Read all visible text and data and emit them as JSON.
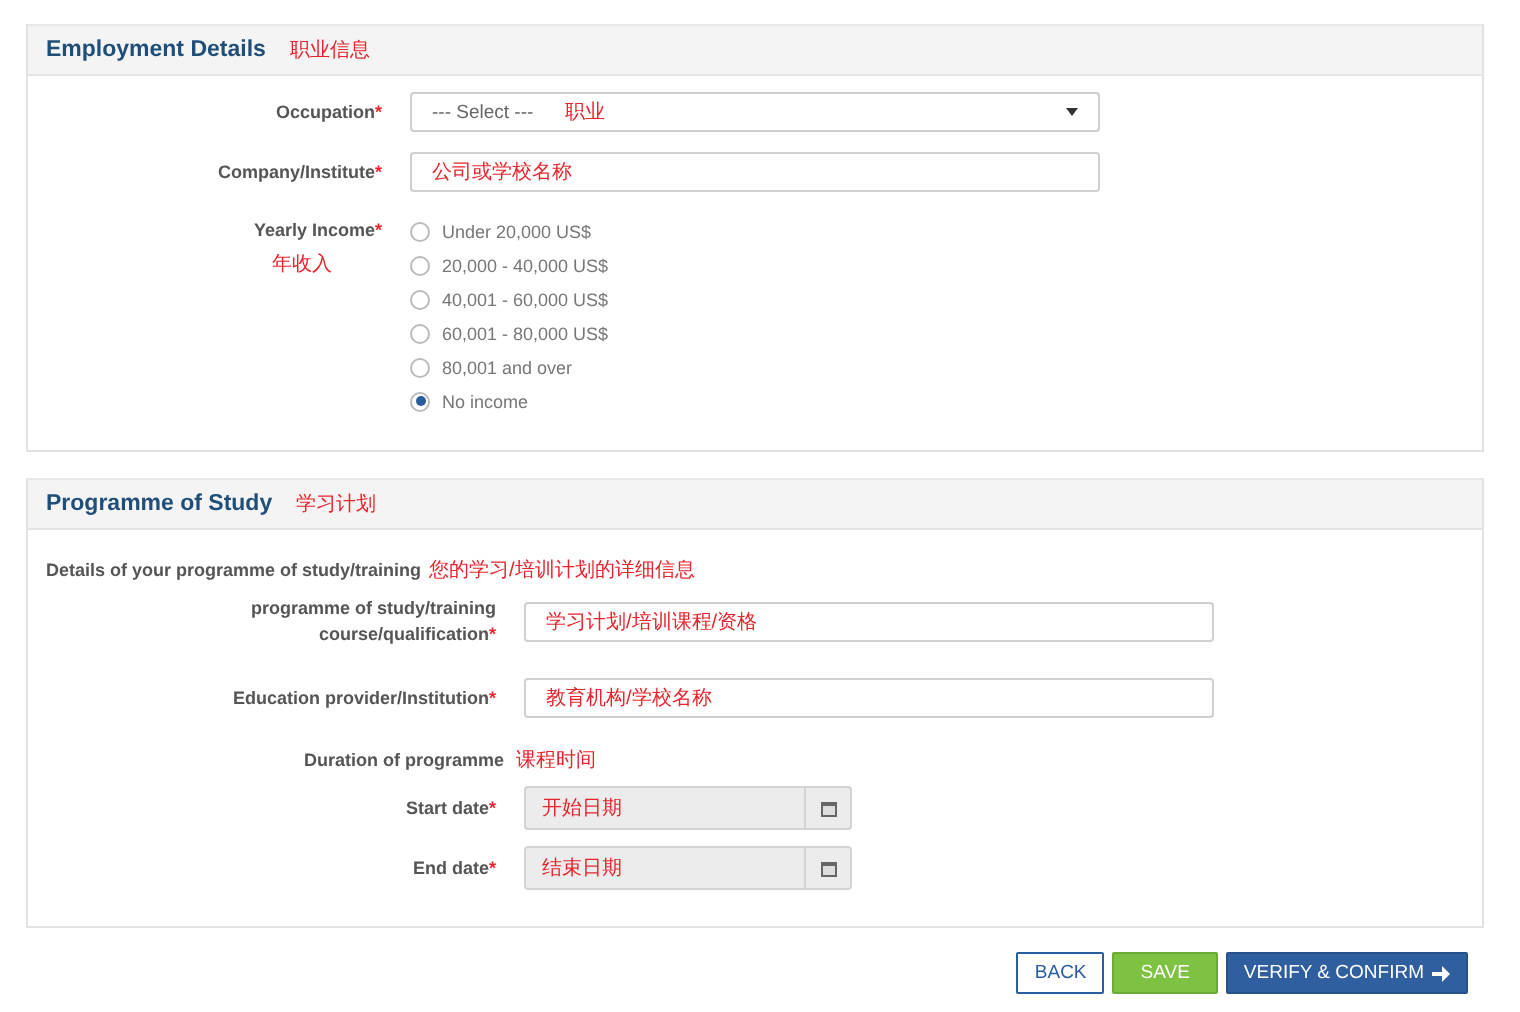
{
  "employment": {
    "title": "Employment Details",
    "annotation": "职业信息",
    "fields": [
      {
        "kind": "select",
        "label": "Occupation",
        "required_mark": "*",
        "placeholder": "--- Select ---",
        "annotation": "职业"
      },
      {
        "kind": "text",
        "label": "Company/Institute",
        "required_mark": "*",
        "annotation": "公司或学校名称"
      },
      {
        "kind": "radio",
        "label": "Yearly Income",
        "required_mark": "*",
        "annotation": "年收入",
        "options": [
          {
            "label": "Under 20,000 US$",
            "selected": false
          },
          {
            "label": "20,000 - 40,000 US$",
            "selected": false
          },
          {
            "label": "40,001 - 60,000 US$",
            "selected": false
          },
          {
            "label": "60,001 - 80,000 US$",
            "selected": false
          },
          {
            "label": "80,001 and over",
            "selected": false
          },
          {
            "label": "No income",
            "selected": true
          }
        ]
      }
    ]
  },
  "programme": {
    "title": "Programme of Study",
    "annotation": "学习计划",
    "intro": {
      "text": "Details of your programme of study/training",
      "annotation": "您的学习/培训计划的详细信息"
    },
    "fields": [
      {
        "kind": "text",
        "label": "programme of study/training course/qualification",
        "required_mark": "*",
        "annotation": "学习计划/培训课程/资格"
      },
      {
        "kind": "text",
        "label": "Education provider/Institution",
        "required_mark": "*",
        "annotation": "教育机构/学校名称"
      },
      {
        "kind": "heading",
        "label": "Duration of programme",
        "annotation": "课程时间"
      },
      {
        "kind": "date",
        "label": "Start date",
        "required_mark": "*",
        "annotation": "开始日期"
      },
      {
        "kind": "date",
        "label": "End date",
        "required_mark": "*",
        "annotation": "结束日期"
      }
    ]
  },
  "buttons": [
    {
      "label": "BACK",
      "kind": "outline"
    },
    {
      "label": "SAVE",
      "kind": "save"
    },
    {
      "label": "VERIFY & CONFIRM",
      "kind": "primary"
    }
  ]
}
